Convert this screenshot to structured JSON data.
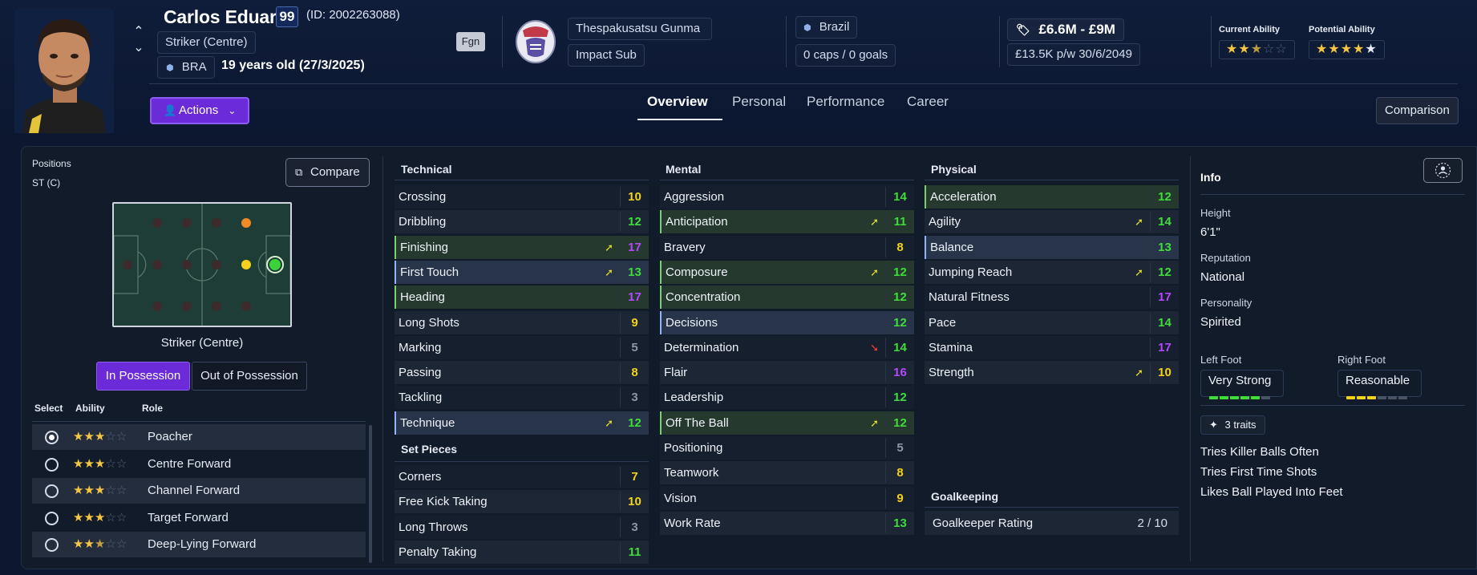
{
  "player": {
    "name": "Carlos Eduardo",
    "ca_badge": "99",
    "id_text": "(ID: 2002263088)",
    "position": "Striker (Centre)",
    "nationality_code": "BRA",
    "age_text": "19 years old (27/3/2025)",
    "fgn_label": "Fgn"
  },
  "club": {
    "name": "Thespakusatsu Gunma",
    "squad_status": "Impact Sub"
  },
  "nation": {
    "name": "Brazil",
    "caps_goals": "0 caps / 0 goals"
  },
  "contract": {
    "value_range": "£6.6M - £9M",
    "wage_expiry": "£13.5K p/w 30/6/2049"
  },
  "ability": {
    "current_label": "Current Ability",
    "current_stars": 2.5,
    "potential_label": "Potential Ability",
    "potential_stars": 4.5
  },
  "nav": {
    "actions_label": "Actions",
    "tabs": [
      "Overview",
      "Personal",
      "Performance",
      "Career"
    ],
    "comparison_label": "Comparison"
  },
  "positions": {
    "title": "Positions",
    "value": "ST (C)",
    "compare_label": "Compare",
    "selected_position": "Striker (Centre)",
    "in_possession": "In Possession",
    "out_of_possession": "Out of Possession"
  },
  "roles": {
    "headers": {
      "select": "Select",
      "ability": "Ability",
      "role": "Role"
    },
    "items": [
      {
        "name": "Poacher",
        "stars": 3,
        "selected": true
      },
      {
        "name": "Centre Forward",
        "stars": 3,
        "selected": false
      },
      {
        "name": "Channel Forward",
        "stars": 3,
        "selected": false
      },
      {
        "name": "Target Forward",
        "stars": 3,
        "selected": false
      },
      {
        "name": "Deep-Lying Forward",
        "stars": 2.5,
        "selected": false
      }
    ]
  },
  "technical": {
    "title": "Technical",
    "items": [
      {
        "name": "Crossing",
        "value": "10"
      },
      {
        "name": "Dribbling",
        "value": "12"
      },
      {
        "name": "Finishing",
        "value": "17",
        "trend": "up",
        "highlight": "green"
      },
      {
        "name": "First Touch",
        "value": "13",
        "trend": "up",
        "highlight": "blue"
      },
      {
        "name": "Heading",
        "value": "17",
        "highlight": "green"
      },
      {
        "name": "Long Shots",
        "value": "9"
      },
      {
        "name": "Marking",
        "value": "5"
      },
      {
        "name": "Passing",
        "value": "8"
      },
      {
        "name": "Tackling",
        "value": "3"
      },
      {
        "name": "Technique",
        "value": "12",
        "trend": "up",
        "highlight": "blue"
      }
    ]
  },
  "set_pieces": {
    "title": "Set Pieces",
    "items": [
      {
        "name": "Corners",
        "value": "7"
      },
      {
        "name": "Free Kick Taking",
        "value": "10"
      },
      {
        "name": "Long Throws",
        "value": "3"
      },
      {
        "name": "Penalty Taking",
        "value": "11"
      }
    ]
  },
  "mental": {
    "title": "Mental",
    "items": [
      {
        "name": "Aggression",
        "value": "14"
      },
      {
        "name": "Anticipation",
        "value": "11",
        "trend": "up",
        "highlight": "green"
      },
      {
        "name": "Bravery",
        "value": "8"
      },
      {
        "name": "Composure",
        "value": "12",
        "trend": "up",
        "highlight": "green"
      },
      {
        "name": "Concentration",
        "value": "12",
        "highlight": "green"
      },
      {
        "name": "Decisions",
        "value": "12",
        "highlight": "blue"
      },
      {
        "name": "Determination",
        "value": "14",
        "trend": "down"
      },
      {
        "name": "Flair",
        "value": "16"
      },
      {
        "name": "Leadership",
        "value": "12"
      },
      {
        "name": "Off The Ball",
        "value": "12",
        "trend": "up",
        "highlight": "green"
      },
      {
        "name": "Positioning",
        "value": "5"
      },
      {
        "name": "Teamwork",
        "value": "8"
      },
      {
        "name": "Vision",
        "value": "9"
      },
      {
        "name": "Work Rate",
        "value": "13"
      }
    ]
  },
  "physical": {
    "title": "Physical",
    "items": [
      {
        "name": "Acceleration",
        "value": "12",
        "highlight": "green"
      },
      {
        "name": "Agility",
        "value": "14",
        "trend": "up"
      },
      {
        "name": "Balance",
        "value": "13",
        "highlight": "blue"
      },
      {
        "name": "Jumping Reach",
        "value": "12",
        "trend": "up"
      },
      {
        "name": "Natural Fitness",
        "value": "17"
      },
      {
        "name": "Pace",
        "value": "14"
      },
      {
        "name": "Stamina",
        "value": "17"
      },
      {
        "name": "Strength",
        "value": "10",
        "trend": "up"
      }
    ]
  },
  "goalkeeping": {
    "title": "Goalkeeping",
    "label": "Goalkeeper Rating",
    "value": "2 / 10"
  },
  "info": {
    "title": "Info",
    "height_label": "Height",
    "height": "6'1\"",
    "reputation_label": "Reputation",
    "reputation": "National",
    "personality_label": "Personality",
    "personality": "Spirited",
    "left_foot_label": "Left Foot",
    "left_foot": "Very Strong",
    "left_foot_level": 5,
    "right_foot_label": "Right Foot",
    "right_foot": "Reasonable",
    "right_foot_level": 3,
    "traits_label": "3 traits",
    "traits": [
      "Tries Killer Balls Often",
      "Tries First Time Shots",
      "Likes Ball Played Into Feet"
    ]
  },
  "colors": {
    "accent": "#6b2bd9",
    "value_green": "#3fdc3a",
    "value_yellow": "#f2d21a",
    "value_purple": "#b248ff",
    "value_grey": "#8e96a6",
    "star": "#f5c544"
  }
}
